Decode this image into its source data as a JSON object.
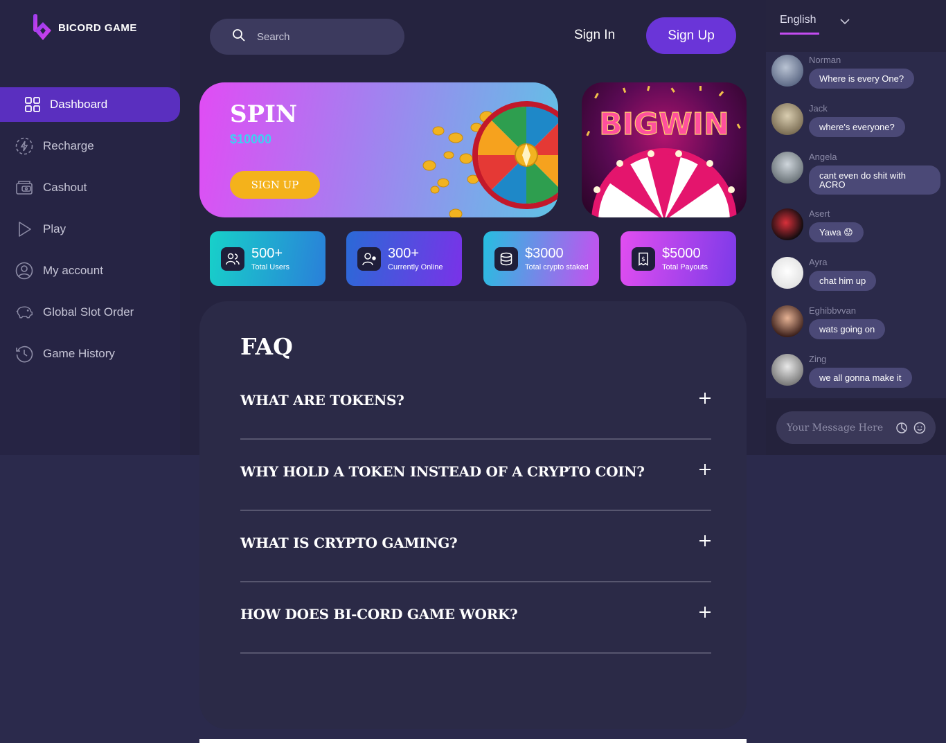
{
  "brand": {
    "name": "BICORD GAME"
  },
  "sidebar": {
    "items": [
      {
        "label": "Dashboard",
        "icon": "grid-icon",
        "active": true
      },
      {
        "label": "Recharge",
        "icon": "lightning-icon"
      },
      {
        "label": "Cashout",
        "icon": "wallet-icon"
      },
      {
        "label": "Play",
        "icon": "play-icon"
      },
      {
        "label": "My account",
        "icon": "user-icon"
      },
      {
        "label": "Global Slot Order",
        "icon": "piggy-bank-icon"
      },
      {
        "label": "Game History",
        "icon": "history-icon"
      }
    ]
  },
  "header": {
    "search_placeholder": "Search",
    "signin_label": "Sign In",
    "signup_label": "Sign Up"
  },
  "promo": {
    "title": "SPIN",
    "amount": "$10000",
    "cta": "SIGN UP",
    "bigwin_text": "BIGWIN"
  },
  "stats": [
    {
      "value": "500+",
      "label": "Total Users",
      "icon": "users-icon"
    },
    {
      "value": "300+",
      "label": "Currently Online",
      "icon": "user-online-icon"
    },
    {
      "value": "$3000",
      "label": "Total crypto staked",
      "icon": "database-icon"
    },
    {
      "value": "$5000",
      "label": "Total Payouts",
      "icon": "receipt-icon"
    }
  ],
  "faq": {
    "title": "FAQ",
    "items": [
      "WHAT ARE TOKENS?",
      "WHY HOLD A TOKEN INSTEAD OF A CRYPTO COIN?",
      "WHAT IS CRYPTO GAMING?",
      "HOW DOES BI-CORD GAME WORK?"
    ]
  },
  "chat": {
    "language": "English",
    "messages": [
      {
        "user": "Norman",
        "text": "Where is every One?"
      },
      {
        "user": "Jack",
        "text": "where's everyone?"
      },
      {
        "user": "Angela",
        "text": "cant even do shit with ACRO"
      },
      {
        "user": "Asert",
        "text": "Yawa 😟"
      },
      {
        "user": "Ayra",
        "text": "chat him up"
      },
      {
        "user": "Eghibbvvan",
        "text": "wats going on"
      },
      {
        "user": "Zing",
        "text": "we all gonna make it"
      }
    ],
    "input_placeholder": "Your Message Here"
  },
  "colors": {
    "accent": "#6a35d8",
    "sidebar_active": "#5a2fbf",
    "background": "#2b2a4c"
  }
}
